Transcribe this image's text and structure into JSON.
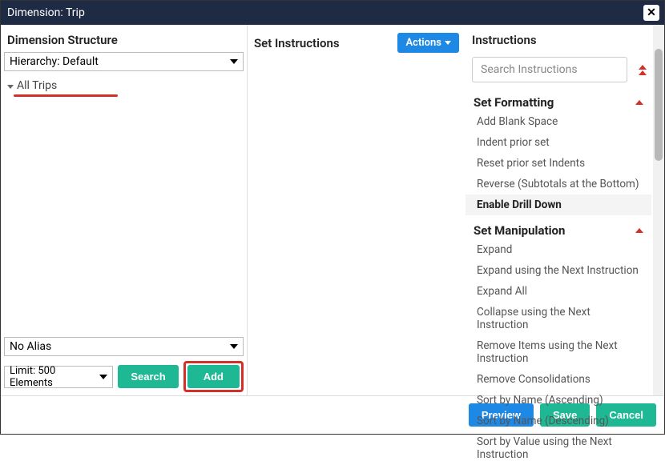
{
  "titlebar": {
    "title": "Dimension: Trip"
  },
  "left": {
    "title": "Dimension Structure",
    "hierarchy": "Hierarchy: Default",
    "tree_root": "All Trips",
    "alias": "No Alias",
    "limit": "Limit: 500 Elements",
    "search_btn": "Search",
    "add_btn": "Add"
  },
  "mid": {
    "title": "Set Instructions",
    "actions": "Actions"
  },
  "right": {
    "title": "Instructions",
    "search_placeholder": "Search Instructions",
    "groups": {
      "formatting": {
        "title": "Set Formatting",
        "items": [
          "Add Blank Space",
          "Indent prior set",
          "Reset prior set Indents",
          "Reverse (Subtotals at the Bottom)",
          "Enable Drill Down"
        ]
      },
      "manipulation": {
        "title": "Set Manipulation",
        "items": [
          "Expand",
          "Expand using the Next Instruction",
          "Expand All",
          "Collapse using the Next Instruction",
          "Remove Items using the Next Instruction",
          "Remove Consolidations",
          "Sort by Name (Ascending)",
          "Sort by Name (Descending)",
          "Sort by Value using the Next Instruction"
        ]
      }
    }
  },
  "footer": {
    "preview": "Preview",
    "save": "Save",
    "cancel": "Cancel"
  }
}
